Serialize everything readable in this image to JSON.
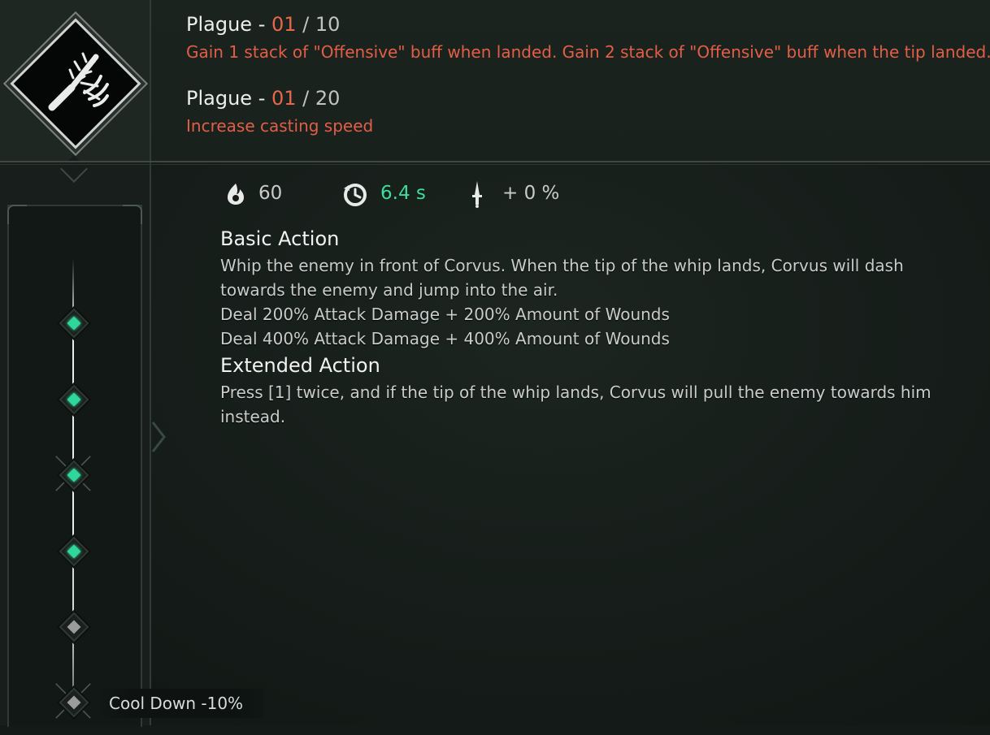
{
  "skill_upgrades": [
    {
      "name": "Plague",
      "separator": " - ",
      "level": "01",
      "max": " / 10",
      "description": "Gain 1 stack of \"Offensive\" buff when landed. Gain 2 stack of \"Offensive\" buff when the tip landed."
    },
    {
      "name": "Plague",
      "separator": " - ",
      "level": "01",
      "max": " / 20",
      "description": "Increase casting speed"
    }
  ],
  "stats": {
    "cost": "60",
    "cooldown": "6.4 s",
    "damage_bonus": "+ 0 %"
  },
  "sections": {
    "basic_title": "Basic Action",
    "basic_lines": [
      "Whip the enemy in front of Corvus. When the tip of the whip lands, Corvus will dash",
      "towards the enemy and jump into the air.",
      "Deal 200% Attack Damage + 200% Amount of Wounds",
      "Deal 400% Attack Damage + 400% Amount of Wounds"
    ],
    "extended_title": "Extended Action",
    "extended_lines": [
      "Press [1] twice, and if the tip of the whip lands, Corvus will pull the enemy towards him",
      "instead."
    ]
  },
  "skill_tree": {
    "nodes": [
      {
        "state": "active"
      },
      {
        "state": "active"
      },
      {
        "state": "active"
      },
      {
        "state": "active"
      },
      {
        "state": "locked"
      },
      {
        "state": "locked"
      }
    ],
    "cooldown_label": "Cool Down -10%"
  },
  "icons": {
    "skill": "whip-skill-icon",
    "cost": "flame-icon",
    "cooldown": "clock-icon",
    "damage": "dagger-icon"
  },
  "colors": {
    "accent_green": "#3fdc9b",
    "accent_red": "#e25e47",
    "node_active": "#2fd79b"
  }
}
